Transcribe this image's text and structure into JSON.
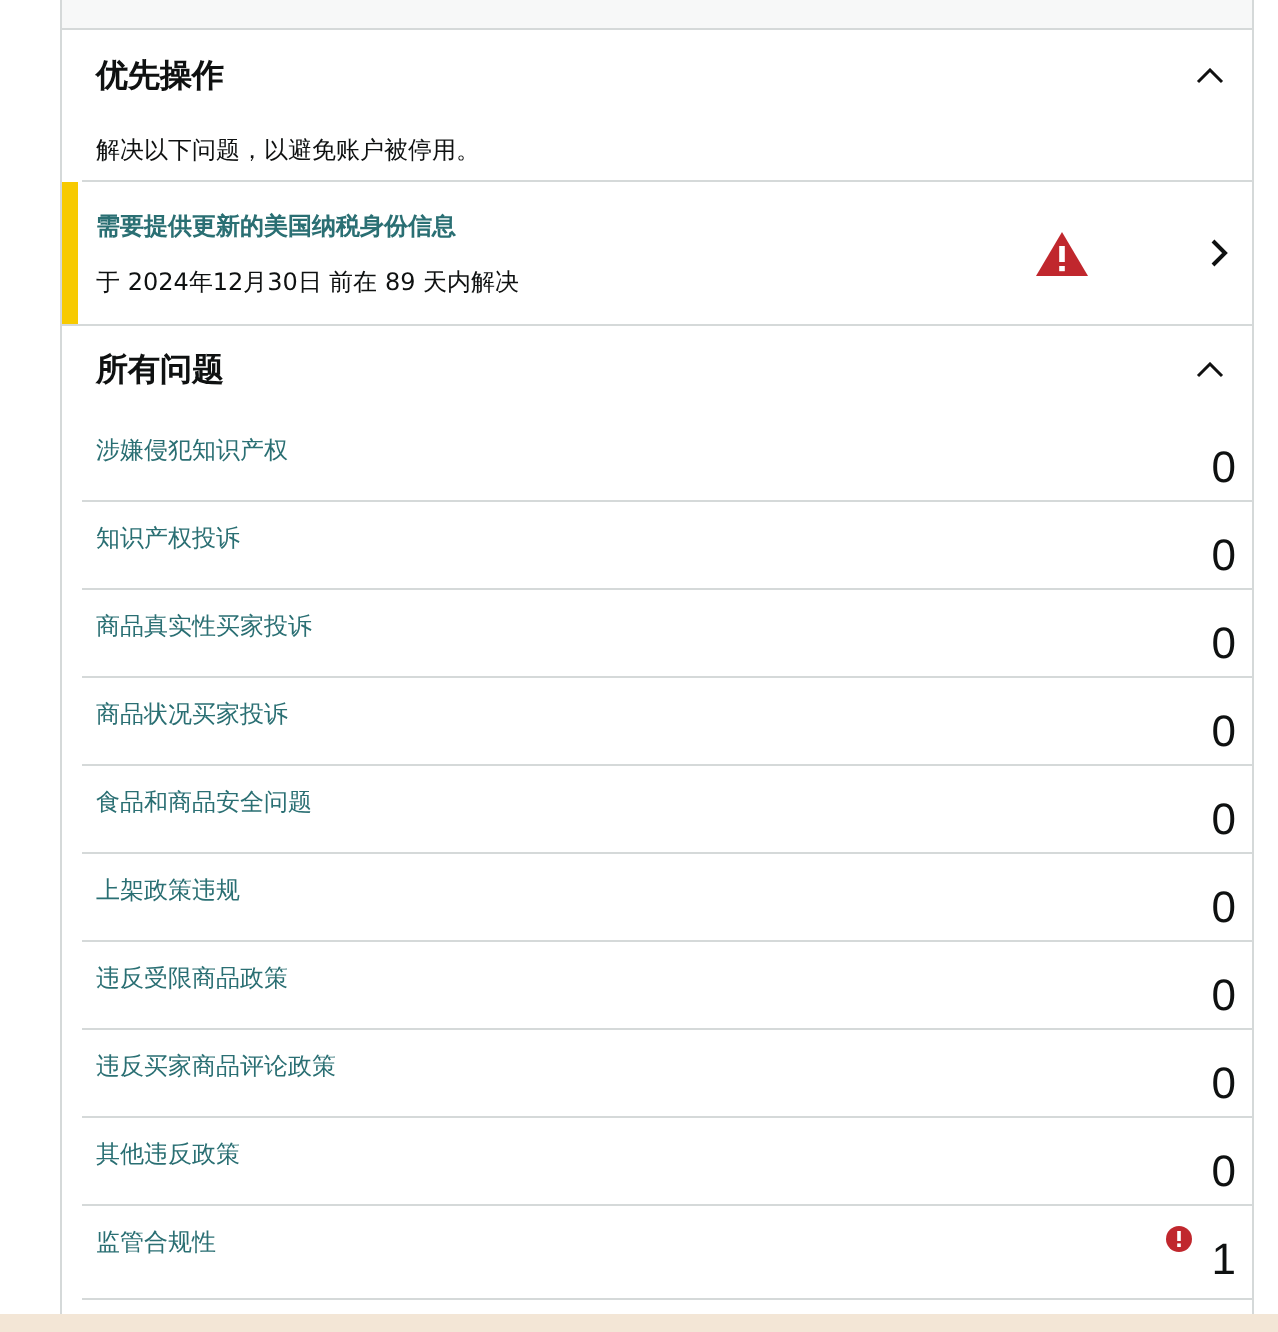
{
  "priority": {
    "title": "优先操作",
    "expanded": true,
    "subtitle": "解决以下问题，以避免账户被停用。",
    "items": [
      {
        "title": "需要提供更新的美国纳税身份信息",
        "detail": "于 2024年12月30日 前在 89 天内解决",
        "warning": true
      }
    ]
  },
  "all_issues": {
    "title": "所有问题",
    "expanded": true,
    "rows": [
      {
        "label": "涉嫌侵犯知识产权",
        "count": "0",
        "alert": false
      },
      {
        "label": "知识产权投诉",
        "count": "0",
        "alert": false
      },
      {
        "label": "商品真实性买家投诉",
        "count": "0",
        "alert": false
      },
      {
        "label": "商品状况买家投诉",
        "count": "0",
        "alert": false
      },
      {
        "label": "食品和商品安全问题",
        "count": "0",
        "alert": false
      },
      {
        "label": "上架政策违规",
        "count": "0",
        "alert": false
      },
      {
        "label": "违反受限商品政策",
        "count": "0",
        "alert": false
      },
      {
        "label": "违反买家商品评论政策",
        "count": "0",
        "alert": false
      },
      {
        "label": "其他违反政策",
        "count": "0",
        "alert": false
      },
      {
        "label": "监管合规性",
        "count": "1",
        "alert": true
      }
    ]
  }
}
